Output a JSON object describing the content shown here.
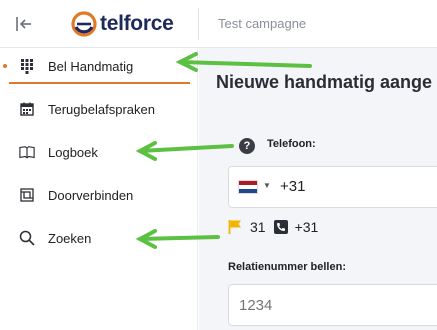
{
  "header": {
    "logo_text": "telforce",
    "campaign": "Test campagne"
  },
  "sidebar": {
    "items": [
      {
        "label": "Bel Handmatig",
        "icon": "dialpad-icon",
        "active": true
      },
      {
        "label": "Terugbelafspraken",
        "icon": "calendar-icon",
        "active": false
      },
      {
        "label": "Logboek",
        "icon": "book-icon",
        "active": false
      },
      {
        "label": "Doorverbinden",
        "icon": "transfer-icon",
        "active": false
      },
      {
        "label": "Zoeken",
        "icon": "search-icon",
        "active": false
      }
    ]
  },
  "main": {
    "title": "Nieuwe handmatig aange",
    "phone": {
      "label": "Telefoon:",
      "country_flag": "nl-flag-icon",
      "value": "+31"
    },
    "dial_info": {
      "code1": "31",
      "code2": "+31"
    },
    "relation": {
      "label": "Relatienummer bellen:",
      "placeholder": "1234"
    }
  },
  "colors": {
    "accent": "#e07a2b",
    "arrow": "#5cc043",
    "brand": "#1f2a5c",
    "flag_yellow": "#f5b400"
  }
}
